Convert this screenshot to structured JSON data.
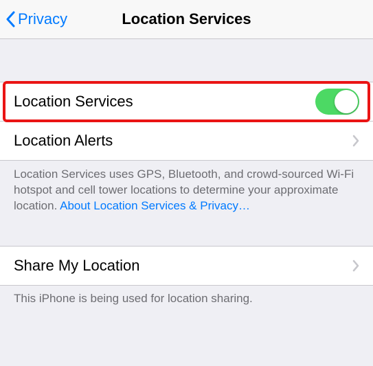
{
  "nav": {
    "back_label": "Privacy",
    "title": "Location Services"
  },
  "rows": {
    "location_services": {
      "label": "Location Services",
      "toggle_on": true
    },
    "location_alerts": {
      "label": "Location Alerts"
    },
    "share_location": {
      "label": "Share My Location"
    }
  },
  "footers": {
    "services_description": "Location Services uses GPS, Bluetooth, and crowd-sourced Wi-Fi hotspot and cell tower locations to determine your approximate location. ",
    "services_link": "About Location Services & Privacy…",
    "share_description": "This iPhone is being used for location sharing."
  }
}
